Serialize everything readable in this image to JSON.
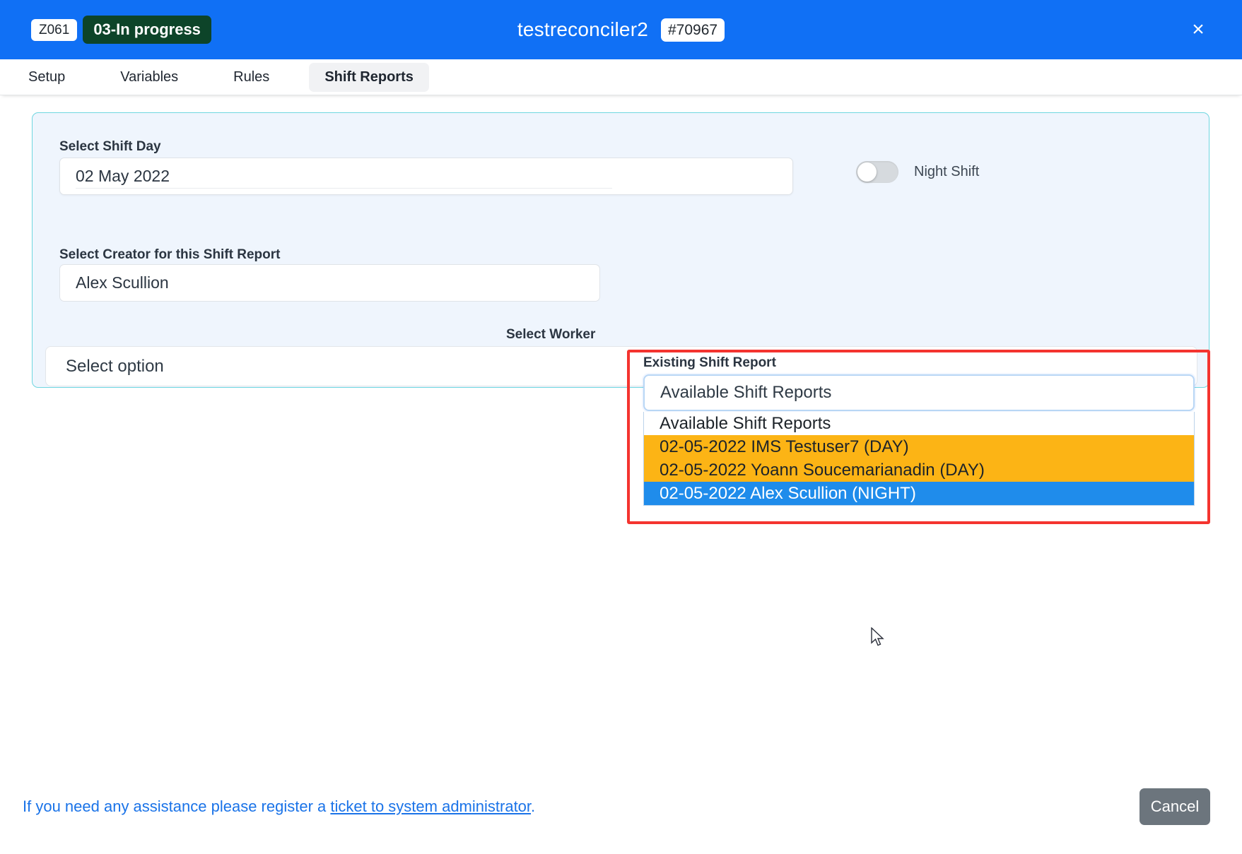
{
  "titlebar": {
    "code_badge": "Z061",
    "status_badge": "03-In progress",
    "title": "testreconciler2",
    "number_badge": "#70967",
    "close_icon": "×"
  },
  "tabs": [
    {
      "label": "Setup",
      "active": false
    },
    {
      "label": "Variables",
      "active": false
    },
    {
      "label": "Rules",
      "active": false
    },
    {
      "label": "Shift Reports",
      "active": true
    }
  ],
  "form": {
    "shift_day_label": "Select Shift Day",
    "shift_day_value": "02 May 2022",
    "night_shift_label": "Night Shift",
    "night_shift_on": false,
    "creator_label": "Select Creator for this Shift Report",
    "creator_value": "Alex Scullion",
    "worker_label": "Select Worker",
    "worker_value": "Select option"
  },
  "existing_shift_report": {
    "label": "Existing Shift Report",
    "selected_value": "Available Shift Reports",
    "options": [
      {
        "text": "Available Shift Reports",
        "state": "plain"
      },
      {
        "text": "02-05-2022 IMS Testuser7 (DAY)",
        "state": "day"
      },
      {
        "text": "02-05-2022 Yoann Soucemarianadin (DAY)",
        "state": "day"
      },
      {
        "text": "02-05-2022 Alex Scullion (NIGHT)",
        "state": "selected"
      }
    ],
    "highlight_color": "#f4342f",
    "day_color": "#fcb415",
    "selected_color": "#1f8ceb"
  },
  "footer": {
    "assistance_prefix": "If you need any assistance please register a ",
    "assistance_link": "ticket to system administrator",
    "assistance_suffix": ".",
    "cancel_label": "Cancel"
  },
  "colors": {
    "titlebar_blue": "#1070f5",
    "status_green": "#0d4429",
    "panel_bg": "#eff5fd",
    "panel_border": "#6fd6e0",
    "link_blue": "#1a73e8",
    "cancel_grey": "#6c757d"
  }
}
